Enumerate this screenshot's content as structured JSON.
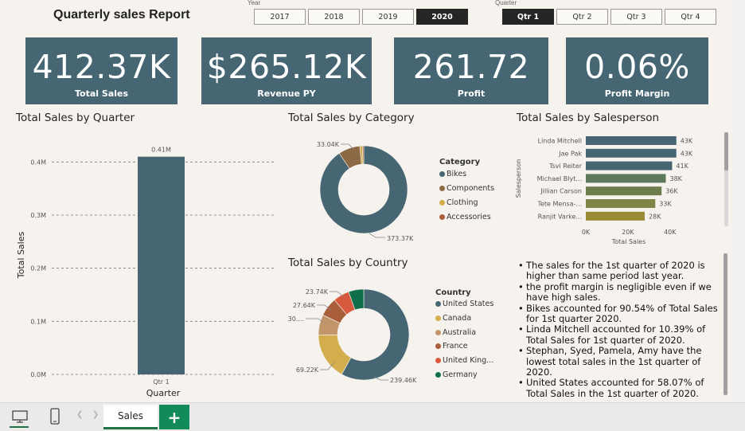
{
  "report": {
    "title": "Quarterly sales Report"
  },
  "year_slicer": {
    "caption": "Year",
    "options": [
      "2017",
      "2018",
      "2019",
      "2020"
    ],
    "selected": "2020"
  },
  "quarter_slicer": {
    "caption": "Quarter",
    "options": [
      "Qtr 1",
      "Qtr 2",
      "Qtr 3",
      "Qtr 4"
    ],
    "selected": "Qtr 1"
  },
  "kpis": [
    {
      "value": "412.37K",
      "label": "Total Sales"
    },
    {
      "value": "$265.12K",
      "label": "Revenue PY"
    },
    {
      "value": "261.72",
      "label": "Profit"
    },
    {
      "value": "0.06%",
      "label": "Profit Margin"
    }
  ],
  "colors": {
    "teal": "#456672",
    "brown": "#8c6a46",
    "gold": "#d4ad4c",
    "tan": "#c2956a",
    "rust": "#a9603a",
    "red": "#d85a3e",
    "green": "#0f6f4a"
  },
  "visual_titles": {
    "by_quarter": "Total Sales by Quarter",
    "by_category": "Total Sales by Category",
    "by_salesperson": "Total Sales by Salesperson",
    "by_country": "Total Sales by Country"
  },
  "category_legend_title": "Category",
  "country_legend_title": "Country",
  "narrative": [
    "The sales for the 1st quarter of 2020 is higher than same period last year.",
    "the profit margin is negligible even if we have high sales.",
    "Bikes accounted for 90.54% of Total Sales for 1st quarter 2020.",
    "Linda Mitchell accounted for 10.39% of Total Sales for 1st quarter of 2020.",
    "Stephan, Syed, Pamela, Amy have the lowest total sales in the 1st quarter of 2020.",
    "United States accounted for 58.07% of Total Sales in the 1st quarter of 2020."
  ],
  "tabs": {
    "active": "Sales",
    "add": "+"
  },
  "chart_data": [
    {
      "type": "bar",
      "title": "Total Sales by Quarter",
      "xlabel": "Quarter",
      "ylabel": "Total Sales",
      "categories": [
        "Qtr 1"
      ],
      "values": [
        410000
      ],
      "data_labels": [
        "0.41M"
      ],
      "yticks": [
        "0.0M",
        "0.1M",
        "0.2M",
        "0.3M",
        "0.4M"
      ],
      "ylim": [
        0,
        0.42
      ],
      "grid": true
    },
    {
      "type": "pie",
      "title": "Total Sales by Category",
      "categories": [
        "Bikes",
        "Components",
        "Clothing",
        "Accessories"
      ],
      "values": [
        373370,
        33040,
        4000,
        1960
      ],
      "data_labels": [
        "373.37K",
        "33.04K"
      ],
      "colors": [
        "#456672",
        "#8c6a46",
        "#d4ad4c",
        "#a9603a"
      ],
      "legend": "right"
    },
    {
      "type": "bar",
      "orientation": "horizontal",
      "title": "Total Sales by Salesperson",
      "ylabel": "Salesperson",
      "xlabel": "Total Sales",
      "categories": [
        "Linda Mitchell",
        "Jae Pak",
        "Tsvi Reiter",
        "Michael Blyt...",
        "Jillian Carson",
        "Tete Mensa-...",
        "Ranjit Varke..."
      ],
      "values": [
        43000,
        43000,
        41000,
        38000,
        36000,
        33000,
        28000
      ],
      "data_labels": [
        "43K",
        "43K",
        "41K",
        "38K",
        "36K",
        "33K",
        "28K"
      ],
      "colors": [
        "#456672",
        "#456672",
        "#456672",
        "#5d7a5c",
        "#6e7c4e",
        "#7f8446",
        "#9a8a35"
      ],
      "xticks": [
        "0K",
        "20K",
        "40K"
      ],
      "xlim": [
        0,
        45000
      ]
    },
    {
      "type": "pie",
      "title": "Total Sales by Country",
      "categories": [
        "United States",
        "Canada",
        "Australia",
        "France",
        "United King...",
        "Germany"
      ],
      "values": [
        239460,
        69220,
        30000,
        27640,
        23740,
        22310
      ],
      "data_labels": [
        "239.46K",
        "69.22K",
        "30....",
        "27.64K",
        "23.74K"
      ],
      "colors": [
        "#456672",
        "#d4ad4c",
        "#c2956a",
        "#a9603a",
        "#d85a3e",
        "#0f6f4a"
      ],
      "legend": "right"
    }
  ]
}
